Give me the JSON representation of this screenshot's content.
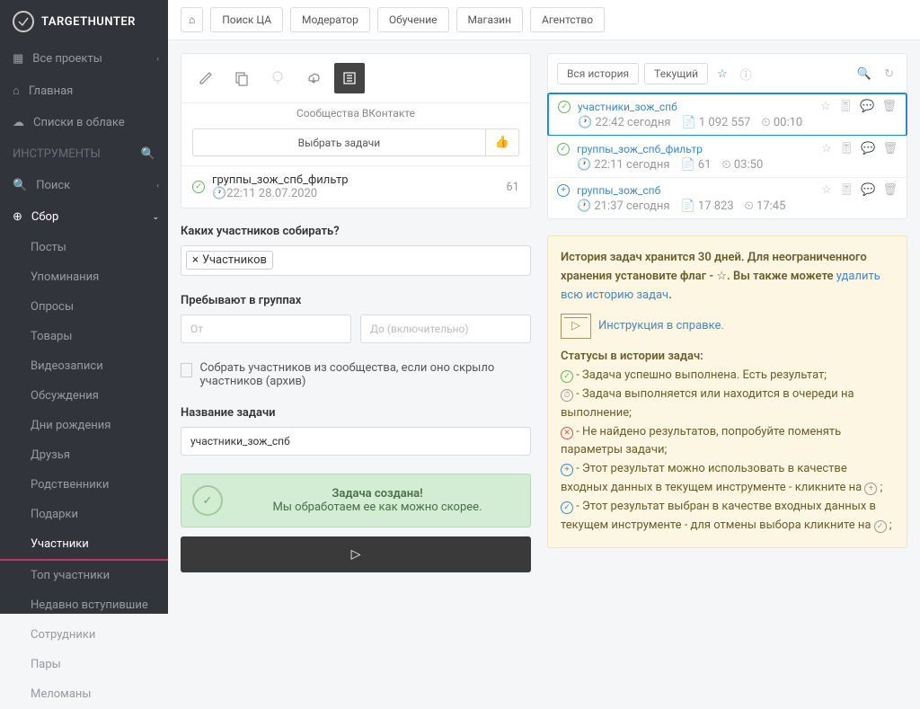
{
  "brand": "TARGETHUNTER",
  "sidebar": {
    "projects": "Все проекты",
    "home": "Главная",
    "cloud_lists": "Списки в облаке",
    "tools_label": "ИНСТРУМЕНТЫ",
    "search": "Поиск",
    "collect": "Сбор",
    "items": [
      "Посты",
      "Упоминания",
      "Опросы",
      "Товары",
      "Видеозаписи",
      "Обсуждения",
      "Дни рождения",
      "Друзья",
      "Родственники",
      "Подарки",
      "Участники",
      "Топ участники",
      "Недавно вступившие",
      "Сотрудники",
      "Пары",
      "Меломаны"
    ]
  },
  "topnav": {
    "search_ca": "Поиск ЦА",
    "moderator": "Модератор",
    "learning": "Обучение",
    "shop": "Магазин",
    "agency": "Агентство"
  },
  "tool_panel": {
    "subtitle": "Сообщества ВКонтакте",
    "select_tasks": "Выбрать задачи",
    "task": {
      "name": "группы_зож_спб_фильтр",
      "time": "22:11 28.07.2020",
      "count": "61"
    }
  },
  "form": {
    "members_label": "Каких участников собирать?",
    "tag": "Участников",
    "groups_label": "Пребывают в группах",
    "from_ph": "От",
    "to_ph": "До (включительно)",
    "checkbox_text": "Собрать участников из сообщества, если оно скрыло участников (архив)",
    "name_label": "Название задачи",
    "name_value": "участники_зож_спб"
  },
  "success": {
    "title": "Задача создана!",
    "sub": "Мы обработаем ее как можно скорее."
  },
  "history": {
    "all": "Вся история",
    "current": "Текущий",
    "items": [
      {
        "title": "участники_зож_спб",
        "time": "22:42 сегодня",
        "count": "1 092 557",
        "dur": "00:10",
        "status": "ok",
        "selected": true
      },
      {
        "title": "группы_зож_спб_фильтр",
        "time": "22:11 сегодня",
        "count": "61",
        "dur": "03:50",
        "status": "ok",
        "selected": false
      },
      {
        "title": "группы_зож_спб",
        "time": "21:37 сегодня",
        "count": "17 823",
        "dur": "17:45",
        "status": "plus",
        "selected": false
      }
    ]
  },
  "info": {
    "line1a": "История задач хранится 30 дней. Для неограниченного хранения установите флаг - ",
    "line1b": ". Вы также можете ",
    "link1": "удалить всю историю задач",
    "instruction": "Инструкция в справке.",
    "status_title": "Статусы в истории задач:",
    "s1": " - Задача успешно выполнена. Есть результат;",
    "s2": " - Задача выполняется или находится в очереди на выполнение;",
    "s3": " - Не найдено результатов, попробуйте поменять параметры задачи;",
    "s4a": " - Этот результат можно использовать в качестве входных данных в текущем инструменте - кликните на ",
    "s4b": " ;",
    "s5a": " - Этот результат выбран в качестве входных данных в текущем инструменте - для отмены выбора кликните на ",
    "s5b": " ;"
  }
}
